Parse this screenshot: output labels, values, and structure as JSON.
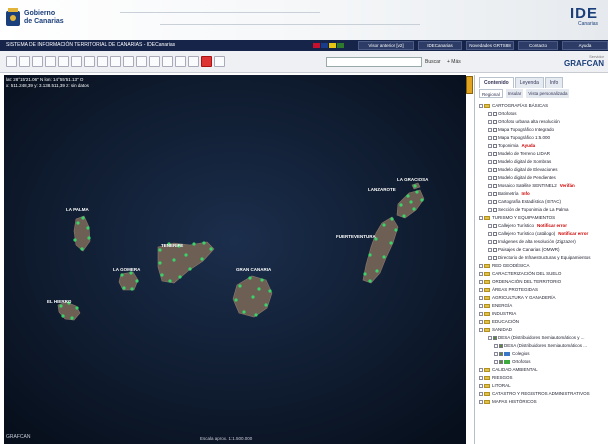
{
  "header": {
    "gov_name_line1": "Gobierno",
    "gov_name_line2": "de Canarias",
    "ide_big": "IDE",
    "ide_small": "Canarias"
  },
  "titlebar": {
    "title": "SISTEMA DE INFORMACIÓN TERRITORIAL DE CANARIAS - IDECanarias",
    "flag_colors": [
      "#c8102e",
      "#1a3c8c",
      "#e8c414",
      "#2d7a2d"
    ],
    "nav": [
      {
        "label": "Visor anterior [v2]"
      },
      {
        "label": "IDECanarias"
      },
      {
        "label": "Novedades GRTS88"
      },
      {
        "label": "Contacto"
      },
      {
        "label": "Ayuda"
      }
    ]
  },
  "toolbar": {
    "search_value": "",
    "search_button": "Buscar",
    "more_button": "+ Más",
    "grafcan_small": "Servidor",
    "grafcan_big": "GRAFCAN"
  },
  "map": {
    "coords_line1": "lat: 28°15'21.06\" N lon: 14°55'51.13\" O",
    "coords_line2": "x: 511.248,39  y: 3.138.511,39  z: sin datos",
    "islands": [
      {
        "name": "LA PALMA"
      },
      {
        "name": "TENERIFE"
      },
      {
        "name": "LA GOMERA"
      },
      {
        "name": "GRAN CANARIA"
      },
      {
        "name": "EL HIERRO"
      },
      {
        "name": "FUERTEVENTURA"
      },
      {
        "name": "LANZAROTE"
      },
      {
        "name": "LA GRACIOSA"
      }
    ],
    "scale_text": "Escala aprox. 1:1.500.000",
    "attribution": "GRAFCAN"
  },
  "panel": {
    "tabs": [
      {
        "label": "Contenido",
        "active": true
      },
      {
        "label": "Leyenda",
        "active": false
      },
      {
        "label": "Info",
        "active": false
      }
    ],
    "subtabs": [
      {
        "label": "Regional",
        "active": true
      },
      {
        "label": "Insular",
        "active": false
      },
      {
        "label": "Vista personalizada",
        "active": false
      }
    ],
    "tree": [
      {
        "level": 1,
        "type": "folder",
        "label": "CARTOGRAFÍAS BÁSICAS"
      },
      {
        "level": 2,
        "type": "check",
        "checked": false,
        "label": "Ortofotos"
      },
      {
        "level": 2,
        "type": "check",
        "checked": false,
        "label": "Ortofoto urbana alta resolución"
      },
      {
        "level": 2,
        "type": "check",
        "checked": false,
        "label": "Mapa Topográfico Integrado"
      },
      {
        "level": 2,
        "type": "check",
        "checked": false,
        "label": "Mapa Topográfico 1:5.000"
      },
      {
        "level": 2,
        "type": "check",
        "checked": false,
        "label": "Toponimia",
        "link": "Ayuda"
      },
      {
        "level": 2,
        "type": "check",
        "checked": false,
        "label": "Modelo de Terreno LIDAR"
      },
      {
        "level": 2,
        "type": "check",
        "checked": false,
        "label": "Modelo digital de Sombras"
      },
      {
        "level": 2,
        "type": "check",
        "checked": false,
        "label": "Modelo digital de Elevaciones"
      },
      {
        "level": 2,
        "type": "check",
        "checked": false,
        "label": "Modelo digital de Pendientes"
      },
      {
        "level": 2,
        "type": "check",
        "checked": false,
        "label": "Mosaico Satélite SENTINEL2",
        "link": "Verifán"
      },
      {
        "level": 2,
        "type": "check",
        "checked": false,
        "label": "Batimetría",
        "link": "Info"
      },
      {
        "level": 2,
        "type": "check",
        "checked": false,
        "label": "Cartografía Estadística (ISTAC)"
      },
      {
        "level": 2,
        "type": "check",
        "checked": false,
        "label": "Sección de Toponimia de La Palma"
      },
      {
        "level": 1,
        "type": "folder",
        "label": "TURISMO Y EQUIPAMIENTOS"
      },
      {
        "level": 2,
        "type": "check",
        "checked": false,
        "label": "Callejero Turístico",
        "link": "Notificar error"
      },
      {
        "level": 2,
        "type": "check",
        "checked": false,
        "label": "Callejero Turístico (catálogo)",
        "link": "Notificar error"
      },
      {
        "level": 2,
        "type": "check",
        "checked": false,
        "label": "Imágenes de alta resolución (Zigzazer)"
      },
      {
        "level": 2,
        "type": "check",
        "checked": false,
        "label": "Paisajes de Canarias (OMWR)"
      },
      {
        "level": 2,
        "type": "check",
        "checked": false,
        "label": "Directorio de Infraestructuras y Equipamientos"
      },
      {
        "level": 1,
        "type": "folder",
        "label": "RED GEODÉSICA"
      },
      {
        "level": 1,
        "type": "folder",
        "label": "CARACTERIZACIÓN DEL SUELO"
      },
      {
        "level": 1,
        "type": "folder",
        "label": "ORDENACIÓN DEL TERRITORIO"
      },
      {
        "level": 1,
        "type": "folder",
        "label": "ÁREAS PROTEGIDAS"
      },
      {
        "level": 1,
        "type": "folder",
        "label": "AGRICULTURA Y GANADERÍA"
      },
      {
        "level": 1,
        "type": "folder",
        "label": "ENERGÍA"
      },
      {
        "level": 1,
        "type": "folder",
        "label": "INDUSTRIA"
      },
      {
        "level": 1,
        "type": "folder",
        "label": "EDUCACIÓN"
      },
      {
        "level": 1,
        "type": "folder",
        "label": "SANIDAD"
      },
      {
        "level": 2,
        "type": "check",
        "checked": true,
        "label": "DESA (Distribuidores Semiautomáticos y ..."
      },
      {
        "level": 3,
        "type": "check",
        "checked": true,
        "label": "DESA (Distribuidores Semiautomáticos ..."
      },
      {
        "level": 3,
        "type": "check",
        "checked": true,
        "label": "Colegios",
        "legend": "#3a78c8"
      },
      {
        "level": 3,
        "type": "check",
        "checked": true,
        "label": "Ortofotos",
        "legend": "#3caa3c"
      },
      {
        "level": 1,
        "type": "folder",
        "label": "CALIDAD AMBIENTAL"
      },
      {
        "level": 1,
        "type": "folder",
        "label": "RIESGOS"
      },
      {
        "level": 1,
        "type": "folder",
        "label": "LITORAL"
      },
      {
        "level": 1,
        "type": "folder",
        "label": "CATASTRO Y REGISTROS ADMINISTRATIVOS"
      },
      {
        "level": 1,
        "type": "folder",
        "label": "MAPAS HISTÓRICOS"
      }
    ]
  },
  "colors": {
    "header_bar": "#17244a",
    "map_background": "#0a1424",
    "island": "#6d5f54",
    "poi_marker": "#3cd26a"
  }
}
